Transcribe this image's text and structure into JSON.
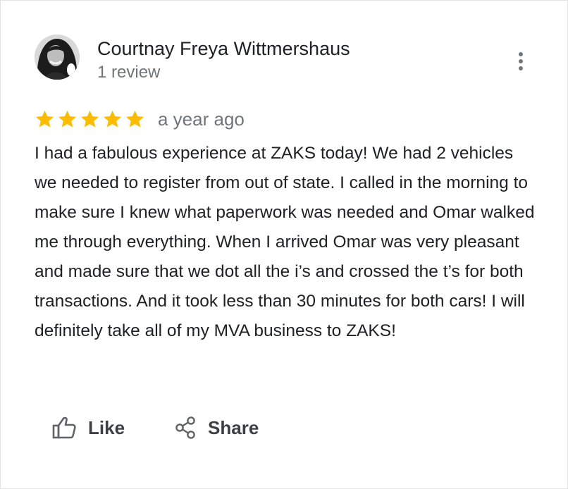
{
  "review": {
    "author_name": "Courtnay Freya Wittmershaus",
    "author_review_count": "1 review",
    "rating": 5,
    "rating_max": 5,
    "date": "a year ago",
    "text": "I had a fabulous experience at ZAKS today! We had 2 vehicles we needed to register from out of state. I called in the morning to make sure I knew what paperwork was needed and Omar walked me through everything. When I arrived Omar was very pleasant and made sure that we dot all the i’s and crossed the t’s for both transactions. And it took less than 30 minutes for both cars! I will definitely take all of my MVA business to ZAKS!"
  },
  "actions": {
    "like_label": "Like",
    "share_label": "Share"
  },
  "icons": {
    "more": "more-vertical-icon",
    "star": "star-icon",
    "like": "thumbs-up-icon",
    "share": "share-icon"
  },
  "colors": {
    "star": "#fbbc04",
    "text_primary": "#202124",
    "text_secondary": "#70757a",
    "action_text": "#3c4043"
  }
}
